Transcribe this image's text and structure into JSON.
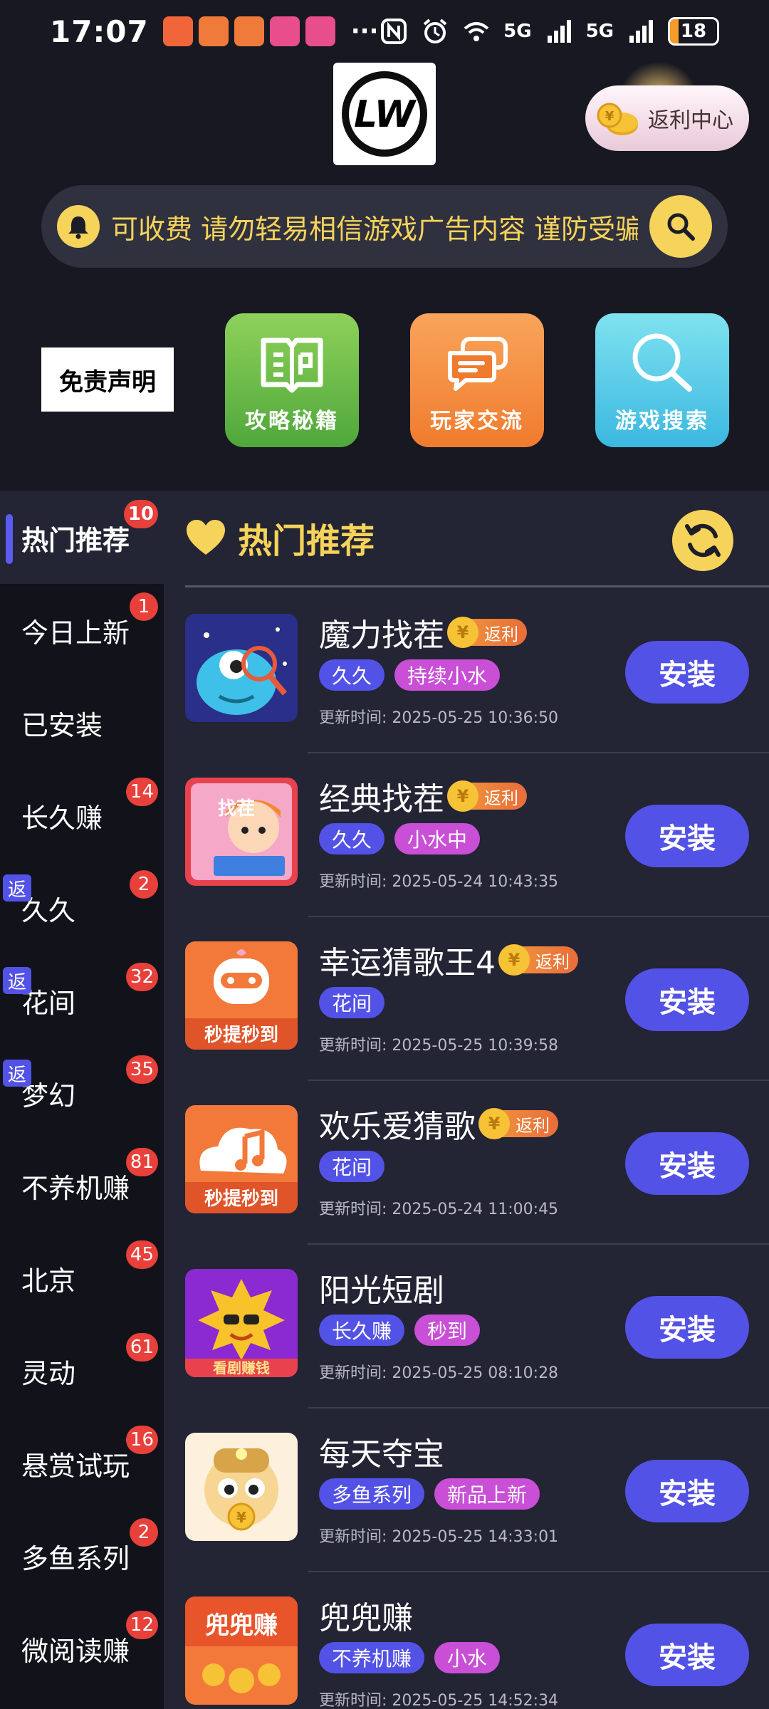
{
  "status_bar": {
    "time": "17:07",
    "more": "···",
    "network_1": "5G",
    "network_2": "5G",
    "battery": "18",
    "battery_level": 0.18,
    "app_icons": [
      "gift-app-icon",
      "app-icon-1",
      "app-icon-2",
      "app-icon-3",
      "app-icon-4"
    ]
  },
  "header": {
    "logo_text": "LW",
    "rebate_center": "返利中心",
    "notice_text": "可收费 请勿轻易相信游戏广告内容 谨防受骗",
    "disclaimer": "免责声明",
    "quick_actions": [
      {
        "label": "攻略秘籍",
        "icon": "book-icon"
      },
      {
        "label": "玩家交流",
        "icon": "chat-icon"
      },
      {
        "label": "游戏搜索",
        "icon": "search-icon"
      }
    ]
  },
  "sidebar": {
    "items": [
      {
        "label": "热门推荐",
        "badge": "10",
        "tag": ""
      },
      {
        "label": "今日上新",
        "badge": "1",
        "tag": ""
      },
      {
        "label": "已安装",
        "badge": "",
        "tag": ""
      },
      {
        "label": "长久赚",
        "badge": "14",
        "tag": ""
      },
      {
        "label": "久久",
        "badge": "2",
        "tag": "返"
      },
      {
        "label": "花间",
        "badge": "32",
        "tag": "返"
      },
      {
        "label": "梦幻",
        "badge": "35",
        "tag": "返"
      },
      {
        "label": "不养机赚",
        "badge": "81",
        "tag": ""
      },
      {
        "label": "北京",
        "badge": "45",
        "tag": ""
      },
      {
        "label": "灵动",
        "badge": "61",
        "tag": ""
      },
      {
        "label": "悬赏试玩",
        "badge": "16",
        "tag": ""
      },
      {
        "label": "多鱼系列",
        "badge": "2",
        "tag": ""
      },
      {
        "label": "微阅读赚",
        "badge": "12",
        "tag": ""
      }
    ]
  },
  "main": {
    "section_title": "热门推荐",
    "apps": [
      {
        "name": "魔力找茬",
        "rebate": "返利",
        "tags": [
          "久久",
          "持续小水"
        ],
        "updated": "更新时间: 2025-05-25 10:36:50",
        "install": "安装"
      },
      {
        "name": "经典找茬",
        "rebate": "返利",
        "tags": [
          "久久",
          "小水中"
        ],
        "updated": "更新时间: 2025-05-24 10:43:35",
        "install": "安装",
        "icon_text": "找茬"
      },
      {
        "name": "幸运猜歌王4",
        "rebate": "返利",
        "tags": [
          "花间"
        ],
        "updated": "更新时间: 2025-05-25 10:39:58",
        "install": "安装",
        "icon_text": "秒提秒到"
      },
      {
        "name": "欢乐爱猜歌",
        "rebate": "返利",
        "tags": [
          "花间"
        ],
        "updated": "更新时间: 2025-05-24 11:00:45",
        "install": "安装",
        "icon_text": "秒提秒到"
      },
      {
        "name": "阳光短剧",
        "rebate": "",
        "tags": [
          "长久赚",
          "秒到"
        ],
        "updated": "更新时间: 2025-05-25 08:10:28",
        "install": "安装",
        "icon_text": "看剧赚钱"
      },
      {
        "name": "每天夺宝",
        "rebate": "",
        "tags": [
          "多鱼系列",
          "新品上新"
        ],
        "updated": "更新时间: 2025-05-25 14:33:01",
        "install": "安装"
      },
      {
        "name": "兜兜赚",
        "rebate": "",
        "tags": [
          "不养机赚",
          "小水"
        ],
        "updated": "更新时间: 2025-05-25 14:52:34",
        "install": "安装",
        "icon_text": "兜兜赚"
      }
    ]
  },
  "colors": {
    "accent_yellow": "#f6d35a",
    "install_blue": "#5352e6",
    "tag_pink": "#c84fd6",
    "badge_red": "#e8403a"
  }
}
